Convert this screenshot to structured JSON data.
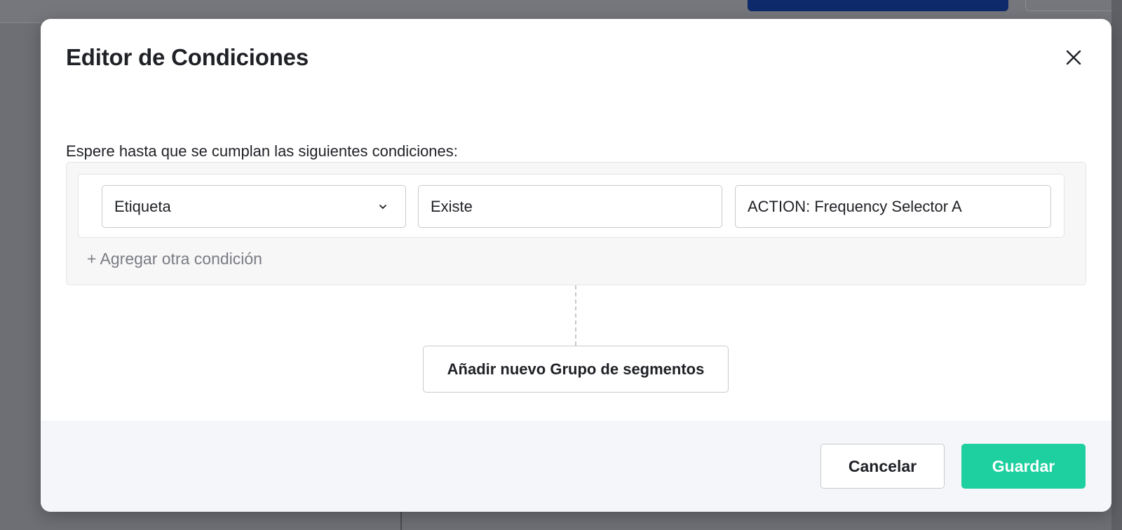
{
  "modal": {
    "title": "Editor de Condiciones",
    "close_icon": "close-icon",
    "instruction": "Espere hasta que se cumplan las siguientes condiciones:"
  },
  "condition": {
    "field": "Etiqueta",
    "operator": "Existe",
    "value": "ACTION: Frequency Selector A",
    "dropdown_icon": "chevron-down-icon"
  },
  "add_condition_label": "+ Agregar otra condición",
  "add_group_label": "Añadir nuevo Grupo de segmentos",
  "footer": {
    "cancel_label": "Cancelar",
    "save_label": "Guardar"
  },
  "colors": {
    "primary_accent": "#1ecf9f",
    "background_button": "#0f2a6b"
  }
}
